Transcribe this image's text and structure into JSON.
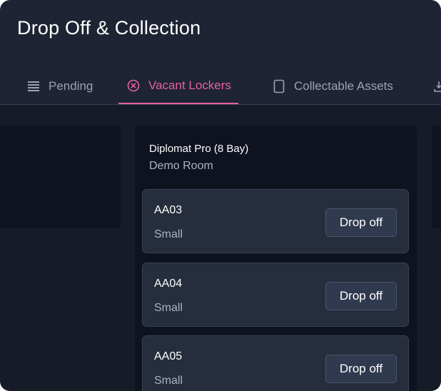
{
  "header": {
    "title": "Drop Off & Collection"
  },
  "tabs": [
    {
      "label": "Pending",
      "icon": "list-icon",
      "active": false
    },
    {
      "label": "Vacant Lockers",
      "icon": "circle-x-icon",
      "active": true
    },
    {
      "label": "Collectable Assets",
      "icon": "tablet-icon",
      "active": false
    }
  ],
  "colors": {
    "accent": "#e65fa8",
    "background": "#1e2433",
    "card": "#0f1320"
  },
  "location": {
    "name": "Diplomat Pro (8 Bay)",
    "room": "Demo Room",
    "lockers": [
      {
        "id": "AA03",
        "size": "Small",
        "action": "Drop off"
      },
      {
        "id": "AA04",
        "size": "Small",
        "action": "Drop off"
      },
      {
        "id": "AA05",
        "size": "Small",
        "action": "Drop off"
      }
    ]
  }
}
